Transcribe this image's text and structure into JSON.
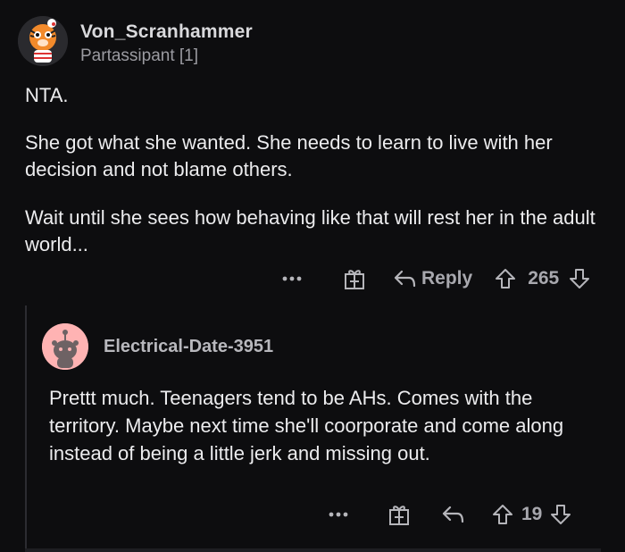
{
  "comment": {
    "username": "Von_Scranhammer",
    "flair": "Partassipant [1]",
    "paragraphs": [
      "NTA.",
      "She got what she wanted. She needs to learn to live with her decision and not blame others.",
      "Wait until she sees how behaving like that will rest her in the adult world..."
    ],
    "actions": {
      "more_icon": "more-dots-icon",
      "award_icon": "gift-icon",
      "reply_label": "Reply",
      "upvote_icon": "upvote-arrow-icon",
      "score": "265",
      "downvote_icon": "downvote-arrow-icon"
    }
  },
  "reply": {
    "username": "Electrical-Date-3951",
    "text": "Prettt much. Teenagers tend to be AHs. Comes with the territory. Maybe next time she'll coorporate and come along instead of being a little jerk and missing out.",
    "actions": {
      "score": "19"
    }
  },
  "colors": {
    "background": "#0d0d0f",
    "text": "#ececee",
    "muted": "#a8a8ae",
    "reply_avatar_bg": "#ffb3b3"
  }
}
